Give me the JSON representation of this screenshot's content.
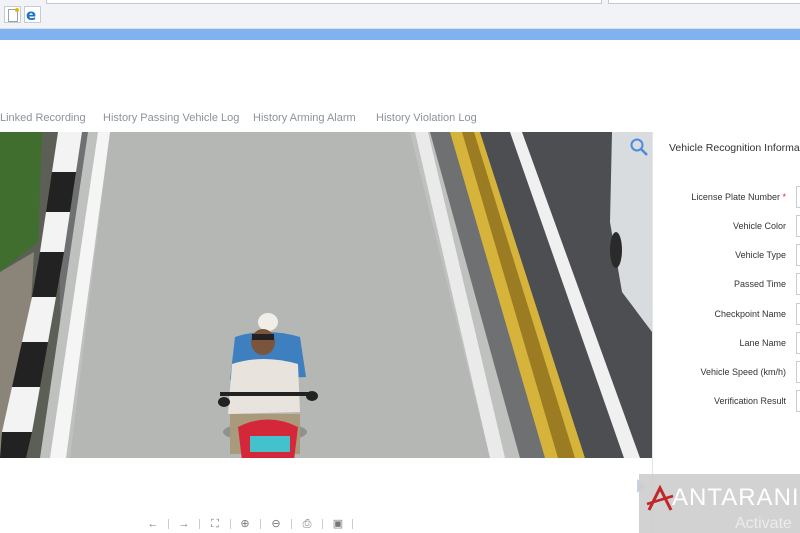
{
  "browser": {
    "tab_icons": [
      "document-icon",
      "internet-explorer-icon"
    ],
    "accent_bar_color": "#7fb2ee"
  },
  "tabs": [
    {
      "label": "Linked Recording"
    },
    {
      "label": "History Passing Vehicle Log"
    },
    {
      "label": "History Arming Alarm"
    },
    {
      "label": "History Violation Log"
    }
  ],
  "side_panel": {
    "title": "Vehicle Recognition Informa",
    "fields": [
      {
        "label": "License Plate Number",
        "required_mark": "*"
      },
      {
        "label": "Vehicle Color"
      },
      {
        "label": "Vehicle Type"
      },
      {
        "label": "Passed Time"
      },
      {
        "label": "Checkpoint Name"
      },
      {
        "label": "Lane Name"
      },
      {
        "label": "Vehicle Speed (km/h)"
      },
      {
        "label": "Verification Result"
      }
    ]
  },
  "toolbar": {
    "prev_icon": "←",
    "next_icon": "→",
    "fit_icon": "⛶",
    "zoom_in_icon": "⊕",
    "zoom_out_icon": "⊖",
    "print_icon": "⎙",
    "save_icon": "▣"
  },
  "watermark": {
    "logo_text": "ANTARANI",
    "activate_text": "Activate"
  }
}
